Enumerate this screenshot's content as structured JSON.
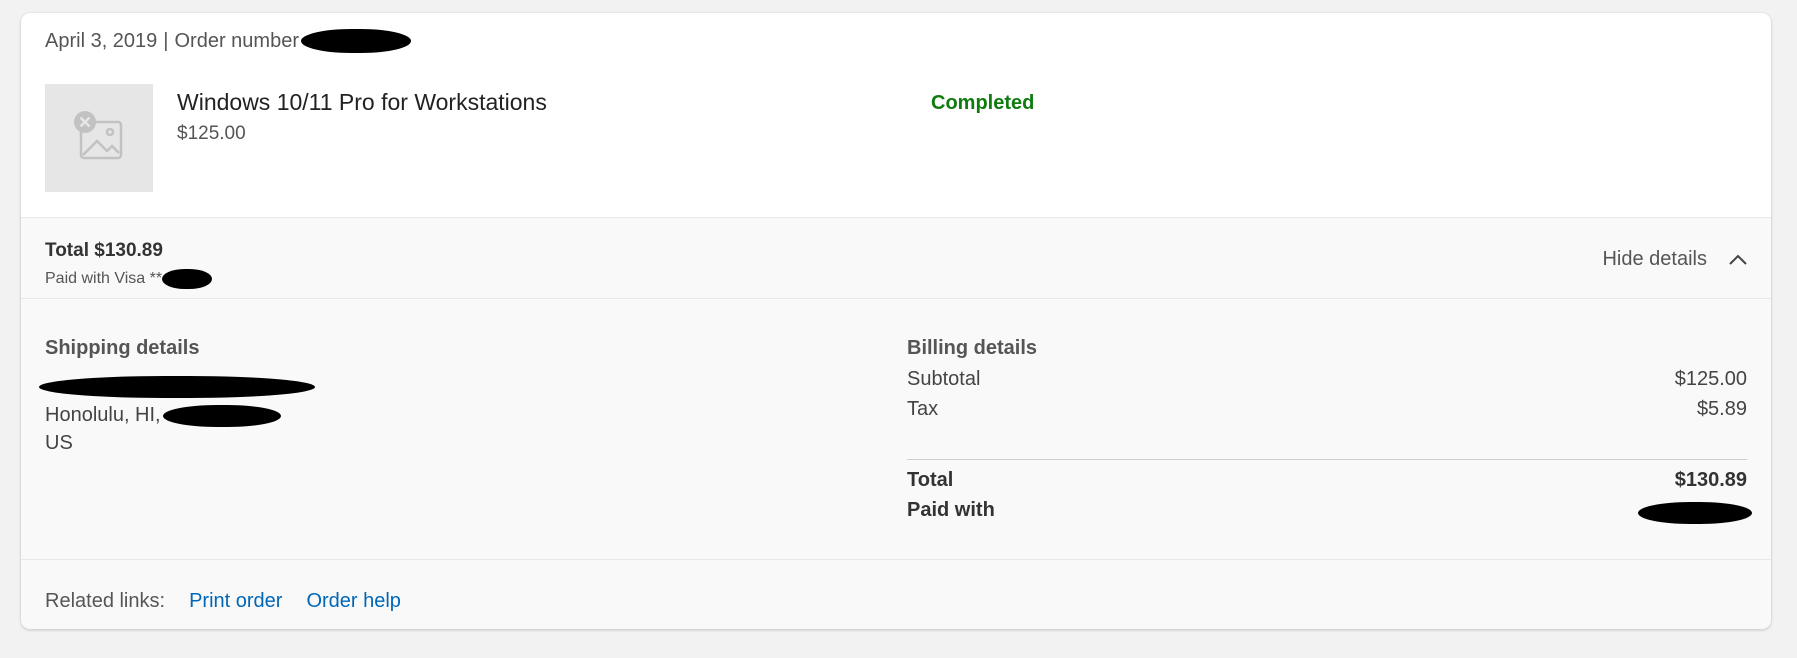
{
  "order": {
    "date": "April 3, 2019",
    "separator": "|",
    "order_number_label": "Order number"
  },
  "product": {
    "name": "Windows 10/11 Pro for Workstations",
    "price": "$125.00",
    "image_icon": "image-placeholder-icon",
    "status": "Completed"
  },
  "summary": {
    "total": "Total $130.89",
    "paid_with": "Paid with Visa **",
    "toggle_label": "Hide details",
    "toggle_icon": "chevron-up-icon"
  },
  "shipping": {
    "title": "Shipping details",
    "city_state": "Honolulu, HI,",
    "country": "US"
  },
  "billing": {
    "title": "Billing details",
    "subtotal_label": "Subtotal",
    "subtotal_value": "$125.00",
    "tax_label": "Tax",
    "tax_value": "$5.89",
    "total_label": "Total",
    "total_value": "$130.89",
    "paid_with_label": "Paid with"
  },
  "related": {
    "label": "Related links:",
    "links": [
      "Print order",
      "Order help"
    ]
  },
  "colors": {
    "status_green": "#107c10",
    "link_blue": "#0067b8",
    "background": "#f2f2f2",
    "card": "#ffffff",
    "band": "#f9f9f9"
  }
}
